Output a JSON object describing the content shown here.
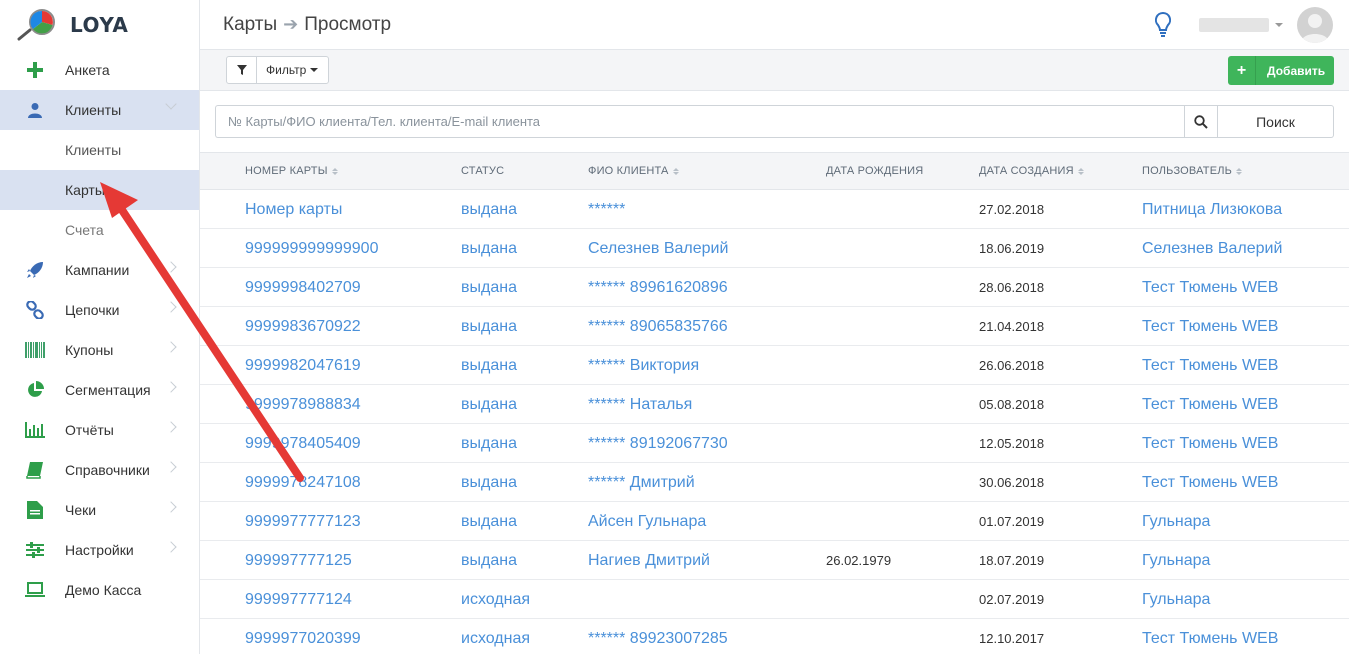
{
  "brand": {
    "name": "LOYA"
  },
  "sidebar": {
    "items": [
      {
        "label": "Анкета",
        "icon": "plus-icon"
      },
      {
        "label": "Клиенты",
        "icon": "user-icon"
      },
      {
        "label": "Кампании",
        "icon": "rocket-icon"
      },
      {
        "label": "Цепочки",
        "icon": "chain-icon"
      },
      {
        "label": "Купоны",
        "icon": "barcode-icon"
      },
      {
        "label": "Сегментация",
        "icon": "pie-icon"
      },
      {
        "label": "Отчёты",
        "icon": "bar-chart-icon"
      },
      {
        "label": "Справочники",
        "icon": "book-icon"
      },
      {
        "label": "Чеки",
        "icon": "document-icon"
      },
      {
        "label": "Настройки",
        "icon": "sliders-icon"
      },
      {
        "label": "Демо Касса",
        "icon": "laptop-icon"
      }
    ],
    "subitems": [
      {
        "label": "Клиенты"
      },
      {
        "label": "Карты"
      },
      {
        "label": "Счета"
      }
    ]
  },
  "header": {
    "breadcrumb": [
      "Карты",
      "Просмотр"
    ]
  },
  "toolbar": {
    "filter_label": "Фильтр",
    "add_label": "Добавить"
  },
  "search": {
    "placeholder": "№ Карты/ФИО клиента/Тел. клиента/E-mail клиента",
    "button_label": "Поиск"
  },
  "table": {
    "columns": [
      "Номер карты",
      "Статус",
      "ФИО клиента",
      "Дата рождения",
      "Дата создания",
      "Пользователь"
    ],
    "rows": [
      [
        "Номер карты",
        "выдана",
        "******",
        "",
        "27.02.2018",
        "Питница Лизюкова"
      ],
      [
        "999999999999900",
        "выдана",
        "Селезнев  Валерий",
        "",
        "18.06.2019",
        "Селезнев Валерий"
      ],
      [
        "9999998402709",
        "выдана",
        "******  89961620896",
        "",
        "28.06.2018",
        "Тест Тюмень WEB"
      ],
      [
        "9999983670922",
        "выдана",
        "******  89065835766",
        "",
        "21.04.2018",
        "Тест Тюмень WEB"
      ],
      [
        "9999982047619",
        "выдана",
        "******  Виктория",
        "",
        "26.06.2018",
        "Тест Тюмень WEB"
      ],
      [
        "9999978988834",
        "выдана",
        "******  Наталья",
        "",
        "05.08.2018",
        "Тест Тюмень WEB"
      ],
      [
        "9999978405409",
        "выдана",
        "******  89192067730",
        "",
        "12.05.2018",
        "Тест Тюмень WEB"
      ],
      [
        "9999978247108",
        "выдана",
        "******  Дмитрий",
        "",
        "30.06.2018",
        "Тест Тюмень WEB"
      ],
      [
        "9999977777123",
        "выдана",
        "Айсен  Гульнара",
        "",
        "01.07.2019",
        "Гульнара"
      ],
      [
        "999997777125",
        "выдана",
        "Нагиев  Дмитрий",
        "26.02.1979",
        "18.07.2019",
        "Гульнара"
      ],
      [
        "999997777124",
        "исходная",
        "",
        "",
        "02.07.2019",
        "Гульнара"
      ],
      [
        "9999977020399",
        "исходная",
        "******  89923007285",
        "",
        "12.10.2017",
        "Тест Тюмень WEB"
      ]
    ]
  },
  "colors": {
    "accent": "#4a90d9",
    "active_bg": "#d9e1f1",
    "add_green": "#3fb55b",
    "annotation_red": "#e53935"
  }
}
